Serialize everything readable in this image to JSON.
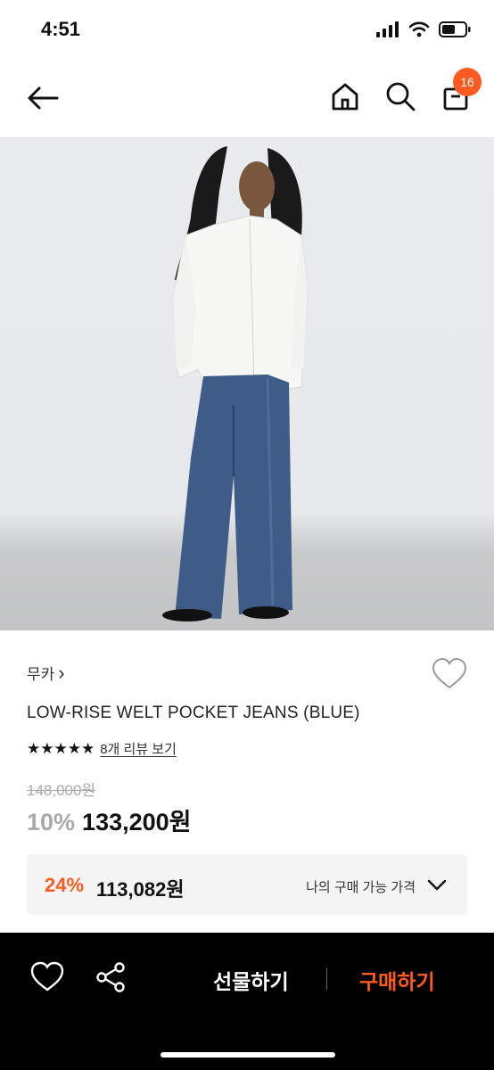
{
  "status": {
    "time": "4:51"
  },
  "nav": {
    "cart_count": "16"
  },
  "product": {
    "brand": "무카",
    "brand_chevron": "›",
    "title": "LOW-RISE WELT POCKET JEANS (BLUE)",
    "rating_stars": "★★★★★",
    "rating_value": 5,
    "review_link": "8개 리뷰 보기",
    "original_price": "148,000원",
    "discount": "10%",
    "sale_price": "133,200원"
  },
  "promo": {
    "percent": "24%",
    "price": "113,082원",
    "label": "나의 구매 가능 가격"
  },
  "bottom": {
    "gift_label": "선물하기",
    "buy_label": "구매하기"
  },
  "colors": {
    "accent": "#ff5a1f",
    "bottom_bar": "#000000"
  }
}
